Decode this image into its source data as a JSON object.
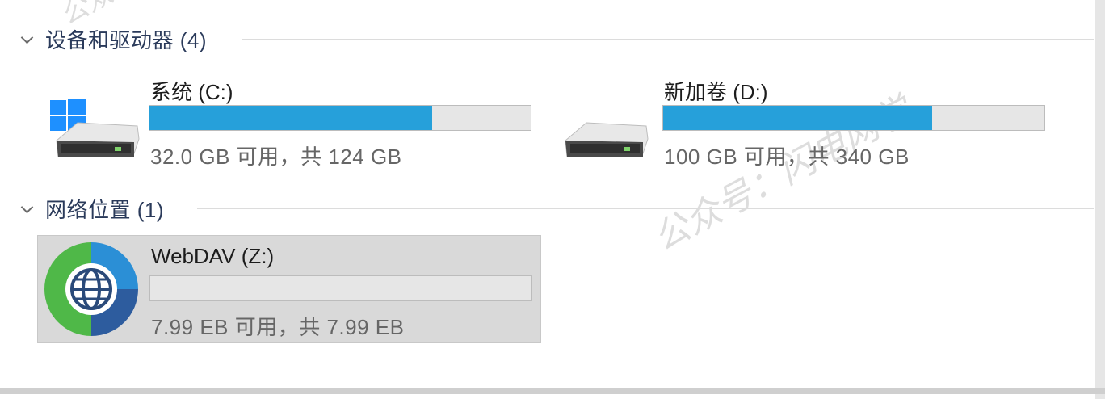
{
  "sections": {
    "devices": {
      "title": "设备和驱动器 (4)",
      "drives": [
        {
          "name": "系统 (C:)",
          "space_text": "32.0 GB 可用，共 124 GB",
          "used_fraction": 0.742,
          "icon": "windows-system-drive-icon"
        },
        {
          "name": "新加卷 (D:)",
          "space_text": "100 GB 可用，共 340 GB",
          "used_fraction": 0.706,
          "icon": "hard-drive-icon"
        }
      ]
    },
    "network": {
      "title": "网络位置 (1)",
      "drives": [
        {
          "name": "WebDAV (Z:)",
          "space_text": "7.99 EB 可用，共 7.99 EB",
          "used_fraction": 0.0,
          "icon": "network-globe-icon"
        }
      ]
    }
  },
  "colors": {
    "bar_fill": "#26a0da",
    "bar_bg": "#e6e6e6",
    "selection": "#d9d9d9"
  },
  "watermark": {
    "text1": "公众号：闪电网学",
    "text2": "公众号"
  }
}
